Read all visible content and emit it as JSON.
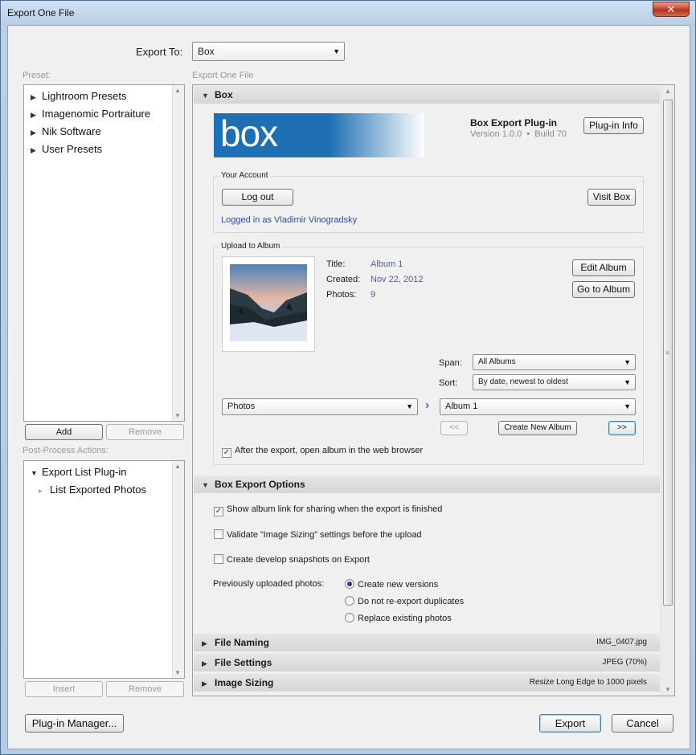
{
  "window": {
    "title": "Export One File",
    "close_glyph": "✕"
  },
  "export_to": {
    "label": "Export To:",
    "value": "Box"
  },
  "preset": {
    "label": "Preset:",
    "items": [
      "Lightroom Presets",
      "Imagenomic Portraiture",
      "Nik Software",
      "User Presets"
    ],
    "add": "Add",
    "remove": "Remove"
  },
  "post_process": {
    "label": "Post-Process Actions:",
    "parent": "Export List Plug-in",
    "child": "List Exported Photos",
    "insert": "Insert",
    "remove": "Remove"
  },
  "right_title": "Export One File",
  "box_section": {
    "header": "Box",
    "logo_text": "box",
    "plugin_name": "Box Export Plug-in",
    "version": "Version 1.0.0",
    "build": "Build 70",
    "plugin_info": "Plug-in Info",
    "account": {
      "title": "Your Account",
      "logout": "Log out",
      "visit": "Visit Box",
      "logged_in": "Logged in as Vladimir Vinogradsky"
    },
    "album": {
      "title": "Upload to Album",
      "title_label": "Title:",
      "title_value": "Album 1",
      "created_label": "Created:",
      "created_value": "Nov 22, 2012",
      "photos_label": "Photos:",
      "photos_value": "9",
      "edit": "Edit Album",
      "goto": "Go to Album",
      "span_label": "Span:",
      "span_value": "All Albums",
      "sort_label": "Sort:",
      "sort_value": "By date, newest to oldest",
      "source_value": "Photos",
      "target_value": "Album 1",
      "prev": "<<",
      "create": "Create New Album",
      "next": ">>",
      "open_after": "After the export, open album in the web browser"
    }
  },
  "options": {
    "header": "Box Export Options",
    "show_link": "Show album link for sharing when the export is finished",
    "validate": "Validate “Image Sizing” settings before the upload",
    "snapshots": "Create develop snapshots on Export",
    "prev_label": "Previously uploaded photos:",
    "radio_new": "Create new versions",
    "radio_dup": "Do not re-export duplicates",
    "radio_replace": "Replace existing photos"
  },
  "collapsed": {
    "file_naming": "File Naming",
    "file_naming_value": "IMG_0407.jpg",
    "file_settings": "File Settings",
    "file_settings_value": "JPEG (70%)",
    "image_sizing": "Image Sizing",
    "image_sizing_value": "Resize Long Edge to 1000 pixels"
  },
  "footer": {
    "plugin_manager": "Plug-in Manager...",
    "export": "Export",
    "cancel": "Cancel"
  },
  "colors": {
    "box_blue": "#1f6fb4",
    "link_blue": "#2e4d8e",
    "accent_focus": "#3c7fb1"
  }
}
